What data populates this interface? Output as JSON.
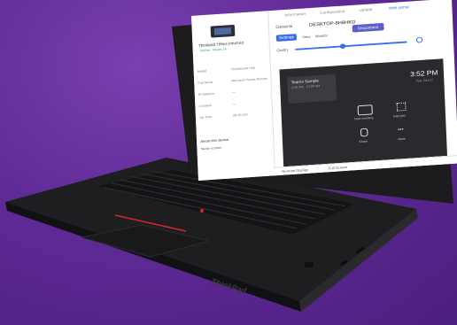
{
  "screen": {
    "device_name": "Thinkpad Office InfoGrid",
    "device_status": "Online · Room 14",
    "tabs": [
      "Information",
      "Configuration",
      "Update",
      "Web portal"
    ],
    "active_tab": "Web portal",
    "left_rows": [
      {
        "label": "Model",
        "value": "ThinkSmart Hub"
      },
      {
        "label": "Full Serial",
        "value": "Microsoft Teams Rooms"
      },
      {
        "label": "IP Address",
        "value": "—"
      },
      {
        "label": "Location",
        "value": "—"
      },
      {
        "label": "Up Time",
        "value": "08:15:22h"
      }
    ],
    "left_footer": "About this device",
    "left_footer_sub": "Serial number",
    "general_label": "General",
    "device_id": "DESKTOP-8H8HKD",
    "settings_button": "Settings",
    "disconnect_button": "Disconnect",
    "view_label": "View",
    "view_value": "Monitor",
    "scale_label": "Quality",
    "meeting_title": "Teams Sample",
    "meeting_sub": "9:00 AM - 10:00 AM",
    "clock_time": "3:52 PM",
    "clock_date": "Tue, Oct 17",
    "actions": [
      {
        "icon": "meeting-icon",
        "label": "New meeting"
      },
      {
        "icon": "dialpad-icon",
        "label": "Dial pad"
      },
      {
        "icon": "share-icon",
        "label": "Share"
      },
      {
        "icon": "more-icon",
        "label": "More"
      }
    ],
    "bottom_left": "Remote Display",
    "bottom_right": "Full Screen"
  },
  "laptop_brand": "ThinkPad",
  "palette": {
    "background": "#5f2a96",
    "laptop": "#1c1c1e",
    "trackpoint": "#d8262b"
  }
}
